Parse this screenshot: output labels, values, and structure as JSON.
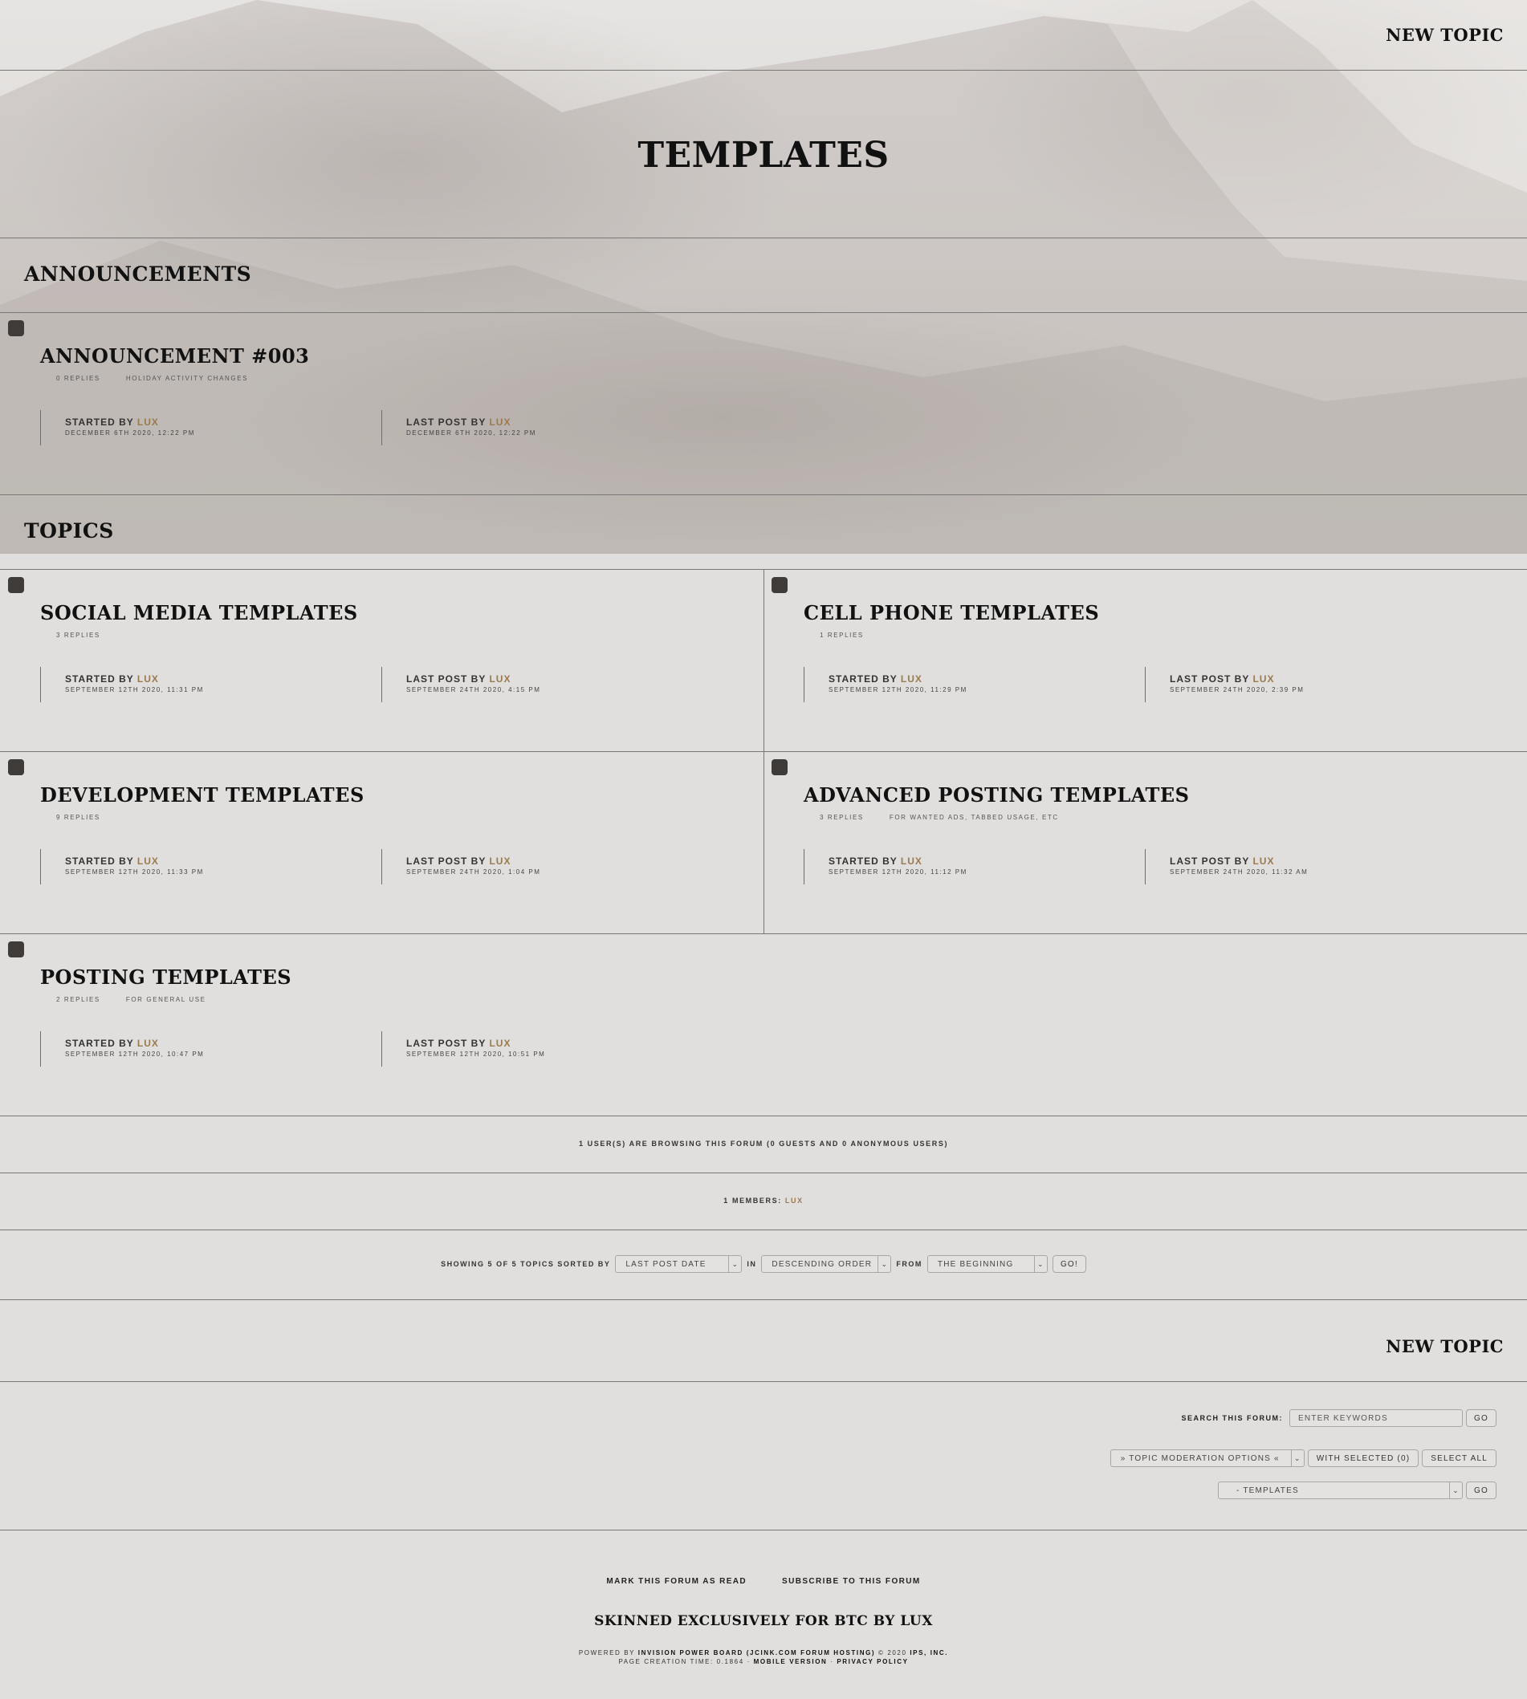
{
  "header": {
    "new_topic": "NEW TOPIC"
  },
  "page_title": "TEMPLATES",
  "announcements": {
    "heading": "ANNOUNCEMENTS",
    "items": [
      {
        "title": "ANNOUNCEMENT #003",
        "replies": "0 REPLIES",
        "description": "HOLIDAY ACTIVITY CHANGES",
        "started_label": "STARTED BY",
        "started_user": "LUX",
        "started_date": "DECEMBER 6TH 2020, 12:22 PM",
        "last_label": "LAST POST BY",
        "last_user": "LUX",
        "last_date": "DECEMBER 6TH 2020, 12:22 PM"
      }
    ]
  },
  "topics": {
    "heading": "TOPICS",
    "items": [
      {
        "title": "SOCIAL MEDIA TEMPLATES",
        "replies": "3 REPLIES",
        "description": "",
        "started_label": "STARTED BY",
        "started_user": "LUX",
        "started_date": "SEPTEMBER 12TH 2020, 11:31 PM",
        "last_label": "LAST POST BY",
        "last_user": "LUX",
        "last_date": "SEPTEMBER 24TH 2020, 4:15 PM"
      },
      {
        "title": "CELL PHONE TEMPLATES",
        "replies": "1 REPLIES",
        "description": "",
        "started_label": "STARTED BY",
        "started_user": "LUX",
        "started_date": "SEPTEMBER 12TH 2020, 11:29 PM",
        "last_label": "LAST POST BY",
        "last_user": "LUX",
        "last_date": "SEPTEMBER 24TH 2020, 2:39 PM"
      },
      {
        "title": "DEVELOPMENT TEMPLATES",
        "replies": "9 REPLIES",
        "description": "",
        "started_label": "STARTED BY",
        "started_user": "LUX",
        "started_date": "SEPTEMBER 12TH 2020, 11:33 PM",
        "last_label": "LAST POST BY",
        "last_user": "LUX",
        "last_date": "SEPTEMBER 24TH 2020, 1:04 PM"
      },
      {
        "title": "ADVANCED POSTING TEMPLATES",
        "replies": "3 REPLIES",
        "description": "FOR WANTED ADS, TABBED USAGE, ETC",
        "started_label": "STARTED BY",
        "started_user": "LUX",
        "started_date": "SEPTEMBER 12TH 2020, 11:12 PM",
        "last_label": "LAST POST BY",
        "last_user": "LUX",
        "last_date": "SEPTEMBER 24TH 2020, 11:32 AM"
      },
      {
        "title": "POSTING TEMPLATES",
        "replies": "2 REPLIES",
        "description": "FOR GENERAL USE",
        "started_label": "STARTED BY",
        "started_user": "LUX",
        "started_date": "SEPTEMBER 12TH 2020, 10:47 PM",
        "last_label": "LAST POST BY",
        "last_user": "LUX",
        "last_date": "SEPTEMBER 12TH 2020, 10:51 PM"
      }
    ]
  },
  "browsing": "1 USER(S) ARE BROWSING THIS FORUM (0 GUESTS AND 0 ANONYMOUS USERS)",
  "members": {
    "label": "1 MEMBERS:",
    "user": "LUX"
  },
  "sort": {
    "prefix": "SHOWING 5 OF 5 TOPICS SORTED BY",
    "sort_by": "LAST POST DATE",
    "in_label": "IN",
    "order": "DESCENDING ORDER",
    "from_label": "FROM",
    "from": "THE BEGINNING",
    "go": "GO!"
  },
  "search": {
    "label": "SEARCH THIS FORUM:",
    "placeholder": "ENTER KEYWORDS",
    "go": "GO"
  },
  "moderation": {
    "options": "» TOPIC MODERATION OPTIONS «",
    "with_selected": "WITH SELECTED (0)",
    "select_all": "SELECT ALL"
  },
  "jump": {
    "forum": "- TEMPLATES",
    "go": "GO"
  },
  "footer": {
    "mark_read": "MARK THIS FORUM AS READ",
    "subscribe": "SUBSCRIBE TO THIS FORUM",
    "credit": "SKINNED EXCLUSIVELY FOR BTC BY LUX",
    "powered_prefix": "POWERED BY",
    "powered_board": "INVISION POWER BOARD",
    "powered_host": "(JCINK.COM FORUM HOSTING)",
    "powered_copy": "© 2020",
    "powered_ips": "IPS, INC.",
    "page_time": "PAGE CREATION TIME: 0.1864 ·",
    "mobile": "MOBILE VERSION",
    "sep": "·",
    "privacy": "PRIVACY POLICY"
  },
  "colors": {
    "accent_user": "#9a7a4e",
    "background": "#e0dfde",
    "icon": "#3e3b39"
  }
}
